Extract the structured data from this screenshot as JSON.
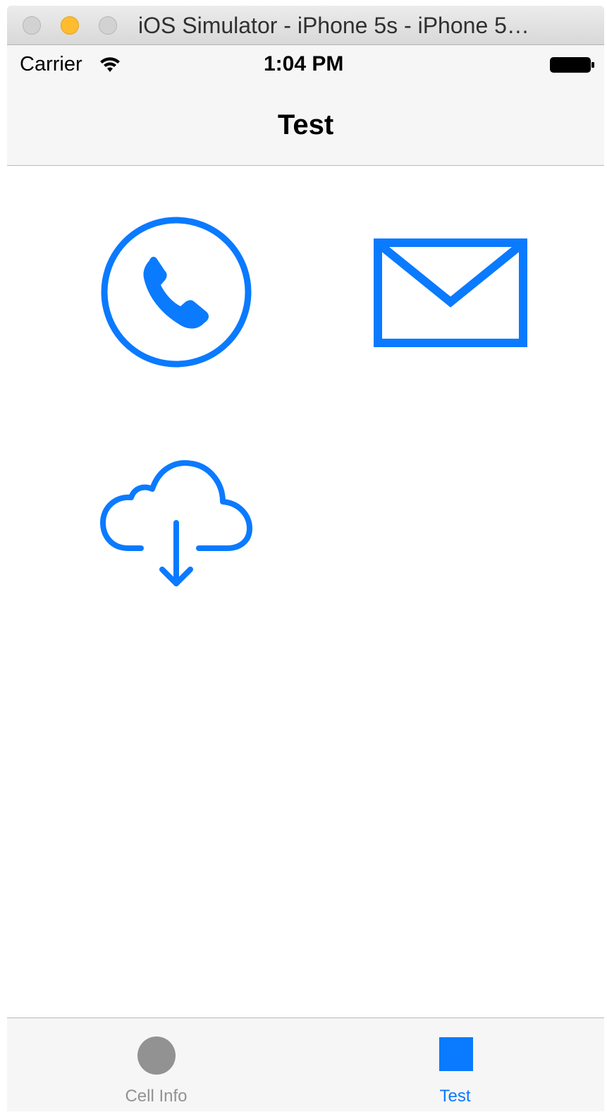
{
  "window": {
    "title": "iOS Simulator - iPhone 5s - iPhone 5…"
  },
  "status_bar": {
    "carrier": "Carrier",
    "time": "1:04 PM",
    "icons": [
      "wifi-icon",
      "battery-icon"
    ]
  },
  "nav_bar": {
    "title": "Test"
  },
  "content": {
    "icons": [
      "phone-icon",
      "mail-icon",
      "cloud-download-icon"
    ]
  },
  "tab_bar": {
    "tabs": [
      {
        "label": "Cell Info",
        "icon": "circle-icon",
        "selected": false
      },
      {
        "label": "Test",
        "icon": "square-icon",
        "selected": true
      }
    ]
  },
  "colors": {
    "tint": "#0a7aff",
    "unselected": "#929292",
    "bar_background": "#f6f6f6"
  }
}
